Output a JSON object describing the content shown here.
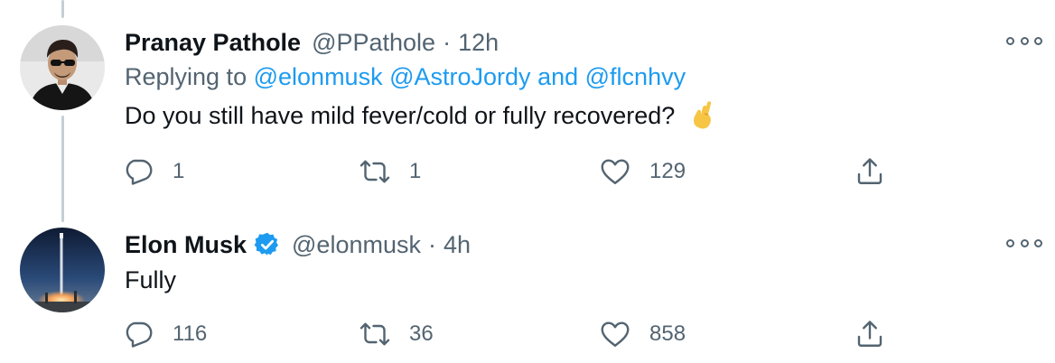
{
  "tweets": [
    {
      "name": "Pranay Pathole",
      "handle": "@PPathole",
      "separator": "·",
      "time": "12h",
      "reply_prefix": "Replying to",
      "reply_mentions": [
        "@elonmusk",
        "@AstroJordy",
        "@flcnhvy"
      ],
      "reply_and": "and",
      "text": "Do you still have mild fever/cold or fully recovered?",
      "emoji_icon": "crossed-fingers-icon",
      "avatar_icon": "profile-photo-sunglasses",
      "verified": false,
      "replies": "1",
      "retweets": "1",
      "likes": "129"
    },
    {
      "name": "Elon Musk",
      "handle": "@elonmusk",
      "separator": "·",
      "time": "4h",
      "text": "Fully",
      "avatar_icon": "profile-photo-rocket-launch",
      "verified": true,
      "replies": "116",
      "retweets": "36",
      "likes": "858"
    }
  ],
  "colors": {
    "link": "#1d9bf0",
    "secondary_text": "#536471",
    "primary_text": "#0f1419",
    "thread_line": "#c4cfd6",
    "verified_badge": "#1d9bf0"
  }
}
